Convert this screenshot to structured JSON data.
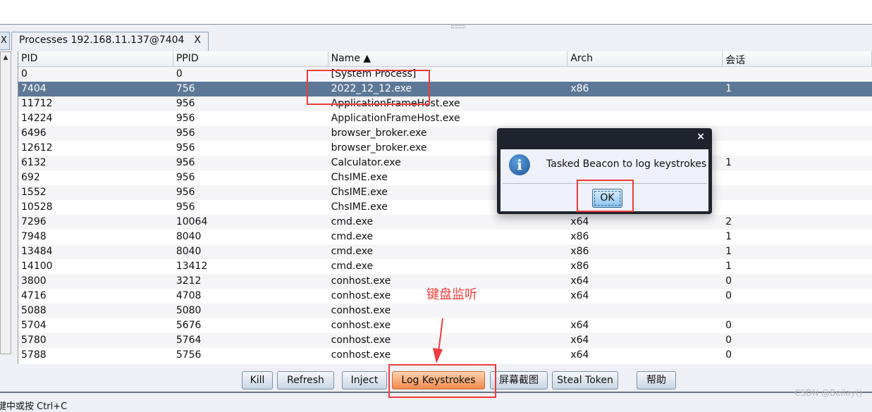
{
  "tabs": {
    "prev_label": "X",
    "active_title": "Processes 192.168.11.137@7404",
    "close_label": "X"
  },
  "table": {
    "columns": [
      "PID",
      "PPID",
      "Name ▲",
      "Arch",
      "会话"
    ],
    "rows": [
      [
        "0",
        "0",
        "[System Process]",
        "",
        ""
      ],
      [
        "7404",
        "756",
        "2022_12_12.exe",
        "x86",
        "1"
      ],
      [
        "11712",
        "956",
        "ApplicationFrameHost.exe",
        "",
        ""
      ],
      [
        "14224",
        "956",
        "ApplicationFrameHost.exe",
        "",
        ""
      ],
      [
        "6496",
        "956",
        "browser_broker.exe",
        "",
        ""
      ],
      [
        "12612",
        "956",
        "browser_broker.exe",
        "",
        ""
      ],
      [
        "6132",
        "956",
        "Calculator.exe",
        "",
        "1"
      ],
      [
        "692",
        "956",
        "ChsIME.exe",
        "",
        ""
      ],
      [
        "1552",
        "956",
        "ChsIME.exe",
        "",
        ""
      ],
      [
        "10528",
        "956",
        "ChsIME.exe",
        "",
        ""
      ],
      [
        "7296",
        "10064",
        "cmd.exe",
        "x64",
        "2"
      ],
      [
        "7948",
        "8040",
        "cmd.exe",
        "x86",
        "1"
      ],
      [
        "13484",
        "8040",
        "cmd.exe",
        "x86",
        "1"
      ],
      [
        "14100",
        "13412",
        "cmd.exe",
        "x86",
        "1"
      ],
      [
        "3800",
        "3212",
        "conhost.exe",
        "x64",
        "0"
      ],
      [
        "4716",
        "4708",
        "conhost.exe",
        "x64",
        "0"
      ],
      [
        "5088",
        "5080",
        "conhost.exe",
        "",
        ""
      ],
      [
        "5704",
        "5676",
        "conhost.exe",
        "x64",
        "0"
      ],
      [
        "5780",
        "5764",
        "conhost.exe",
        "x64",
        "0"
      ],
      [
        "5788",
        "5756",
        "conhost.exe",
        "x64",
        "0"
      ]
    ],
    "selected_pid": "7404"
  },
  "buttons": {
    "kill": "Kill",
    "refresh": "Refresh",
    "inject": "Inject",
    "log_keystrokes": "Log Keystrokes",
    "screenshot": "屏幕截图",
    "steal_token": "Steal Token",
    "help": "帮助"
  },
  "dialog": {
    "close": "×",
    "icon": "info-icon",
    "message": "Tasked Beacon to log keystrokes",
    "ok": "OK"
  },
  "status": "键中或按 Ctrl+C",
  "annotation": "键盘监听",
  "watermark": "CSDN @Beilay()",
  "colors": {
    "selected_row": "#5d7896",
    "annotation": "#ee3b3b",
    "highlight_button": "#f08a4c"
  }
}
